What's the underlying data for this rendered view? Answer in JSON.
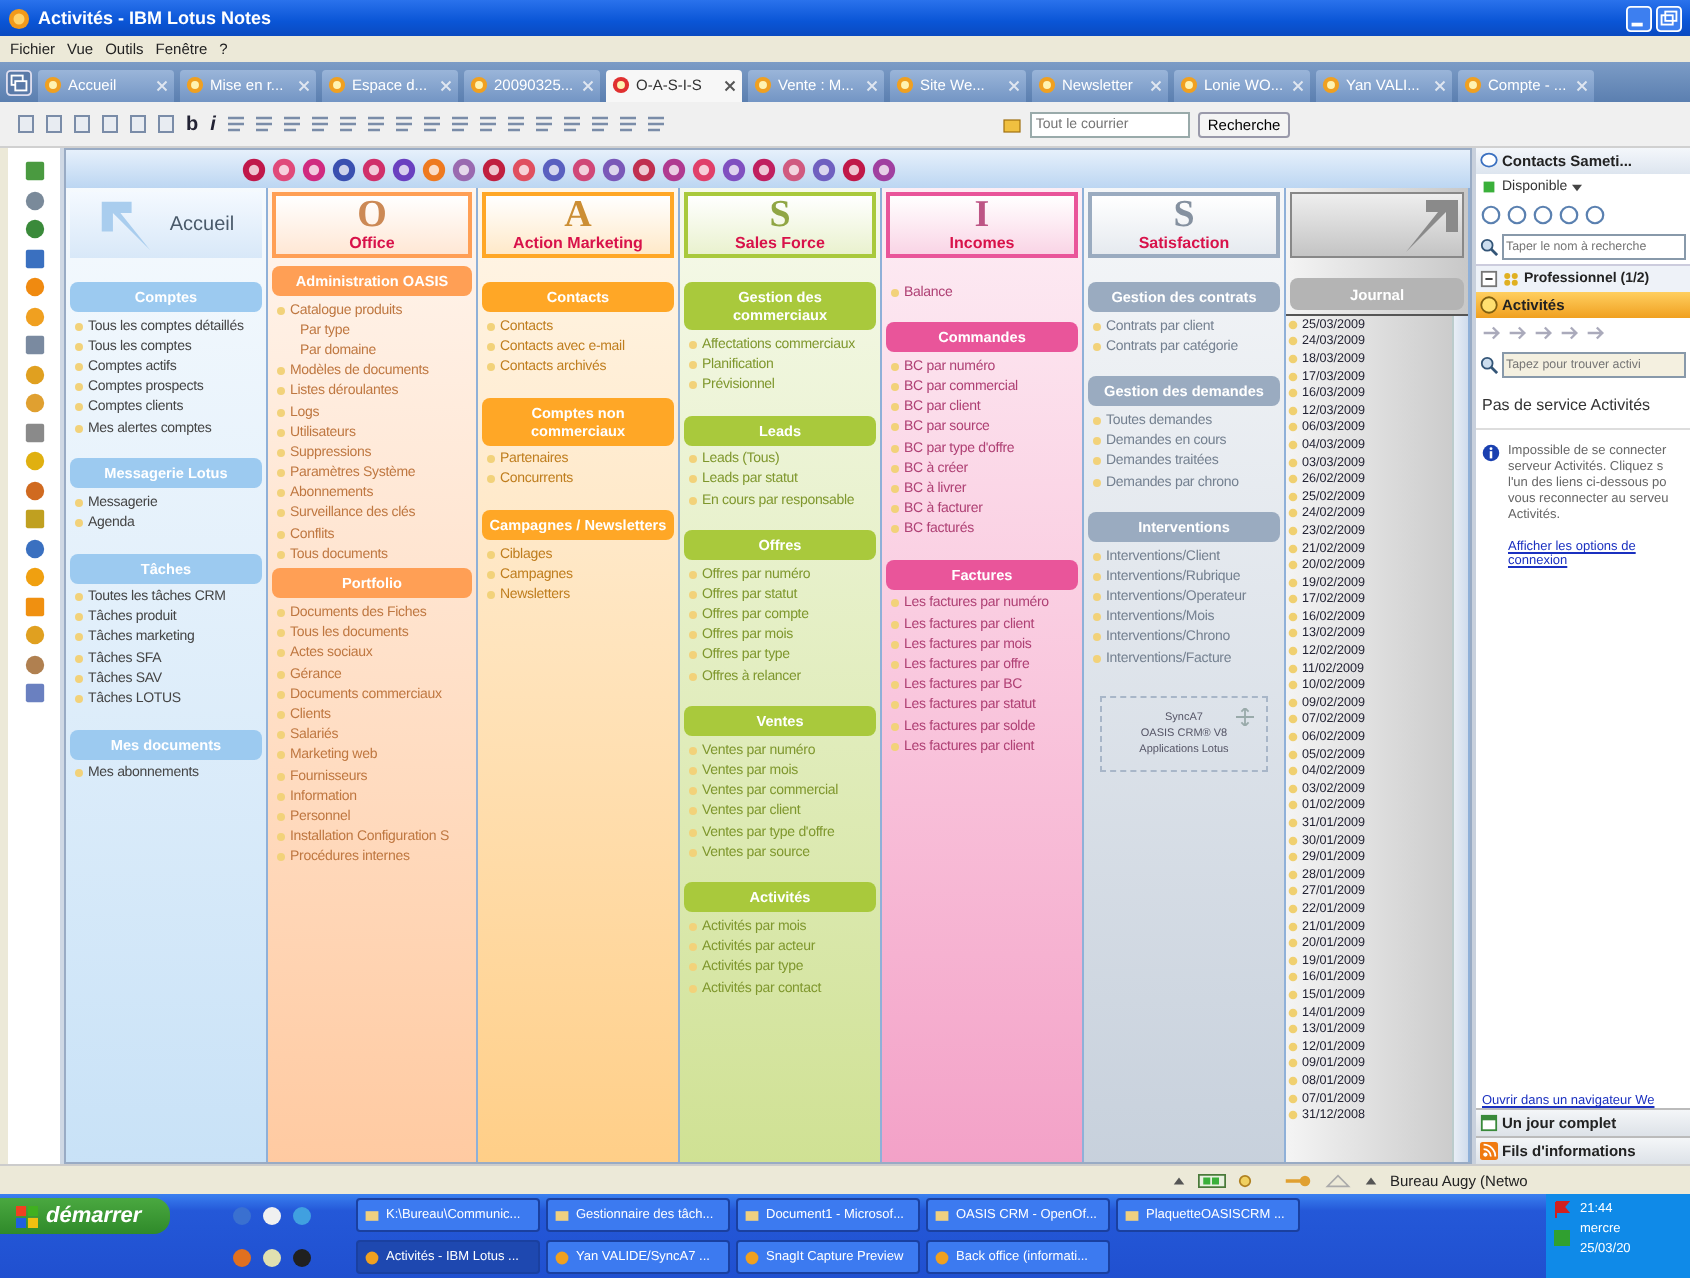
{
  "window": {
    "title": "Activités - IBM Lotus Notes"
  },
  "menu": [
    "Fichier",
    "Vue",
    "Outils",
    "Fenêtre",
    "?"
  ],
  "tabs": [
    {
      "label": "Accueil",
      "selected": false
    },
    {
      "label": "Mise en r...",
      "selected": false
    },
    {
      "label": "Espace d...",
      "selected": false
    },
    {
      "label": "20090325...",
      "selected": false
    },
    {
      "label": "O-A-S-I-S",
      "selected": true
    },
    {
      "label": "Vente : M...",
      "selected": false
    },
    {
      "label": "Site We...",
      "selected": false
    },
    {
      "label": "Newsletter",
      "selected": false
    },
    {
      "label": "Lonie WO...",
      "selected": false
    },
    {
      "label": "Yan VALI...",
      "selected": false
    },
    {
      "label": "Compte - ...",
      "selected": false
    }
  ],
  "toolbar": {
    "glyphs": [
      "b",
      "i"
    ],
    "search_placeholder": "Tout le courrier",
    "search_button": "Recherche"
  },
  "columns": [
    {
      "kind": "home",
      "title": "Accueil",
      "color": "#9ccaf0",
      "sections": [
        {
          "title": "Comptes",
          "items": [
            {
              "label": "Tous les comptes détaillés"
            },
            {
              "label": "Tous les comptes"
            },
            {
              "label": "Comptes actifs"
            },
            {
              "label": "Comptes prospects"
            },
            {
              "label": "Comptes clients"
            },
            {
              "label": "Mes alertes comptes"
            }
          ]
        },
        {
          "title": "Messagerie Lotus",
          "items": [
            {
              "label": "Messagerie"
            },
            {
              "label": "Agenda"
            }
          ]
        },
        {
          "title": "Tâches",
          "items": [
            {
              "label": "Toutes les tâches CRM"
            },
            {
              "label": "Tâches produit"
            },
            {
              "label": "Tâches marketing"
            },
            {
              "label": "Tâches SFA"
            },
            {
              "label": "Tâches SAV"
            },
            {
              "label": "Tâches LOTUS"
            }
          ]
        },
        {
          "title": "Mes documents",
          "items": [
            {
              "label": "Mes abonnements"
            }
          ]
        }
      ]
    },
    {
      "kind": "letter",
      "title": "Office",
      "letter": "O",
      "color": "#ff9f55",
      "sections": [
        {
          "title": "Administration  OASIS",
          "items": [
            {
              "label": "Catalogue produits",
              "children": [
                {
                  "label": "Par type"
                },
                {
                  "label": "Par domaine"
                }
              ]
            },
            {
              "label": "Modèles de documents"
            },
            {
              "label": "Listes déroulantes"
            },
            {
              "label": "Logs"
            },
            {
              "label": "Utilisateurs"
            },
            {
              "label": "Suppressions"
            },
            {
              "label": "Paramètres Système"
            },
            {
              "label": "Abonnements"
            },
            {
              "label": "Surveillance des clés"
            },
            {
              "label": "Conflits"
            },
            {
              "label": "Tous documents"
            }
          ]
        },
        {
          "title": "Portfolio",
          "items": [
            {
              "label": "Documents des Fiches"
            },
            {
              "label": "Tous les documents"
            },
            {
              "label": "Actes sociaux"
            },
            {
              "label": "Gérance"
            },
            {
              "label": "Documents commerciaux"
            },
            {
              "label": "Clients"
            },
            {
              "label": "Salariés"
            },
            {
              "label": "Marketing web"
            },
            {
              "label": "Fournisseurs"
            },
            {
              "label": "Information"
            },
            {
              "label": "Personnel"
            },
            {
              "label": "Installation Configuration S"
            },
            {
              "label": "Procédures internes"
            }
          ]
        }
      ]
    },
    {
      "kind": "letter",
      "title": "Action Marketing",
      "letter": "A",
      "color": "#ffa726",
      "sections": [
        {
          "title": "Contacts",
          "items": [
            {
              "label": "Contacts"
            },
            {
              "label": "Contacts avec e-mail"
            },
            {
              "label": "Contacts archivés"
            }
          ]
        },
        {
          "title": "Comptes non commerciaux",
          "items": [
            {
              "label": "Partenaires"
            },
            {
              "label": "Concurrents"
            }
          ]
        },
        {
          "title": "Campagnes / Newsletters",
          "items": [
            {
              "label": "Ciblages"
            },
            {
              "label": "Campagnes"
            },
            {
              "label": "Newsletters"
            }
          ]
        }
      ]
    },
    {
      "kind": "letter",
      "title": "Sales Force",
      "letter": "S",
      "color": "#a9c93c",
      "sections": [
        {
          "title": "Gestion des commerciaux",
          "items": [
            {
              "label": "Affectations commerciaux"
            },
            {
              "label": "Planification"
            },
            {
              "label": "Prévisionnel"
            }
          ]
        },
        {
          "title": "Leads",
          "items": [
            {
              "label": "Leads (Tous)"
            },
            {
              "label": "Leads par statut"
            },
            {
              "label": "En cours par responsable"
            }
          ]
        },
        {
          "title": "Offres",
          "items": [
            {
              "label": "Offres par numéro"
            },
            {
              "label": "Offres par statut"
            },
            {
              "label": "Offres par compte"
            },
            {
              "label": "Offres par mois"
            },
            {
              "label": "Offres par type"
            },
            {
              "label": "Offres à relancer"
            }
          ]
        },
        {
          "title": "Ventes",
          "items": [
            {
              "label": "Ventes par numéro"
            },
            {
              "label": "Ventes par mois"
            },
            {
              "label": "Ventes par commercial"
            },
            {
              "label": "Ventes par client"
            },
            {
              "label": "Ventes par type d'offre"
            },
            {
              "label": "Ventes par source"
            }
          ]
        },
        {
          "title": "Activités",
          "items": [
            {
              "label": "Activités par mois"
            },
            {
              "label": "Activités par acteur"
            },
            {
              "label": "Activités par type"
            },
            {
              "label": "Activités par contact"
            }
          ]
        }
      ]
    },
    {
      "kind": "letter",
      "title": "Incomes",
      "letter": "I",
      "color": "#e9559a",
      "sections": [
        {
          "items": [
            {
              "label": "Balance"
            }
          ]
        },
        {
          "title": "Commandes",
          "items": [
            {
              "label": "BC par numéro"
            },
            {
              "label": "BC par commercial"
            },
            {
              "label": "BC par client"
            },
            {
              "label": "BC par source"
            },
            {
              "label": "BC par type d'offre"
            },
            {
              "label": "BC à créer"
            },
            {
              "label": "BC à livrer"
            },
            {
              "label": "BC à facturer"
            },
            {
              "label": "BC facturés"
            }
          ]
        },
        {
          "title": "Factures",
          "items": [
            {
              "label": "Les factures par numéro"
            },
            {
              "label": "Les factures par client"
            },
            {
              "label": "Les factures par mois"
            },
            {
              "label": "Les factures par offre"
            },
            {
              "label": "Les factures par BC"
            },
            {
              "label": "Les factures par statut"
            },
            {
              "label": "Les factures par solde"
            },
            {
              "label": "Les factures par client"
            }
          ]
        }
      ]
    },
    {
      "kind": "letter",
      "title": "Satisfaction",
      "letter": "S",
      "color": "#9aabc0",
      "sections": [
        {
          "title": "Gestion des contrats",
          "items": [
            {
              "label": "Contrats par client"
            },
            {
              "label": "Contrats par catégorie"
            }
          ]
        },
        {
          "title": "Gestion des demandes",
          "items": [
            {
              "label": "Toutes demandes"
            },
            {
              "label": "Demandes en cours"
            },
            {
              "label": "Demandes traitées"
            },
            {
              "label": "Demandes par chrono"
            }
          ]
        },
        {
          "title": "Interventions",
          "items": [
            {
              "label": "Interventions/Client"
            },
            {
              "label": "Interventions/Rubrique"
            },
            {
              "label": "Interventions/Operateur"
            },
            {
              "label": "Interventions/Mois"
            },
            {
              "label": "Interventions/Chrono"
            },
            {
              "label": "Interventions/Facture"
            }
          ]
        }
      ],
      "logo_box": [
        "SyncA7",
        "OASIS CRM® V8",
        "Applications Lotus"
      ]
    },
    {
      "kind": "journal",
      "title": "Journal",
      "color": "#b4b4b4",
      "dates": [
        "25/03/2009",
        "24/03/2009",
        "18/03/2009",
        "17/03/2009",
        "16/03/2009",
        "12/03/2009",
        "06/03/2009",
        "04/03/2009",
        "03/03/2009",
        "26/02/2009",
        "25/02/2009",
        "24/02/2009",
        "23/02/2009",
        "21/02/2009",
        "20/02/2009",
        "19/02/2009",
        "17/02/2009",
        "16/02/2009",
        "13/02/2009",
        "12/02/2009",
        "11/02/2009",
        "10/02/2009",
        "09/02/2009",
        "07/02/2009",
        "06/02/2009",
        "05/02/2009",
        "04/02/2009",
        "03/02/2009",
        "01/02/2009",
        "31/01/2009",
        "30/01/2009",
        "29/01/2009",
        "28/01/2009",
        "27/01/2009",
        "22/01/2009",
        "21/01/2009",
        "20/01/2009",
        "19/01/2009",
        "16/01/2009",
        "15/01/2009",
        "14/01/2009",
        "13/01/2009",
        "12/01/2009",
        "09/01/2009",
        "08/01/2009",
        "07/01/2009",
        "31/12/2008"
      ]
    }
  ],
  "side_panel": {
    "contacts_title": "Contacts Sameti...",
    "status": "Disponible",
    "search_placeholder": "Taper le nom à recherche",
    "group": "Professionnel (1/2)",
    "activities_title": "Activités",
    "activities_search_placeholder": "Tapez pour trouver activi",
    "message_title": "Pas de service Activités",
    "message_lines": [
      "Impossible de se connecter",
      "serveur Activités. Cliquez s",
      "l'un des liens ci-dessous po",
      "vous reconnecter au serveu",
      "Activités."
    ],
    "options_link": "Afficher les options de connexion",
    "browser_link": "Ouvrir dans un navigateur We",
    "day_title": "Un jour complet",
    "feeds_title": "Fils d'informations"
  },
  "status_bar": {
    "location": "Bureau Augy (Netwo"
  },
  "taskbar": {
    "start": "démarrer",
    "windows_top": [
      "K:\\Bureau\\Communic...",
      "Gestionnaire des tâch...",
      "Document1 - Microsof...",
      "OASIS CRM - OpenOf...",
      "PlaquetteOASISCRM ..."
    ],
    "windows_bottom": [
      "Activités - IBM Lotus ...",
      "Yan VALIDE/SyncA7 ...",
      "SnagIt Capture Preview",
      "Back office (informati..."
    ],
    "time": "21:44",
    "day": "mercre",
    "date": "25/03/20"
  }
}
